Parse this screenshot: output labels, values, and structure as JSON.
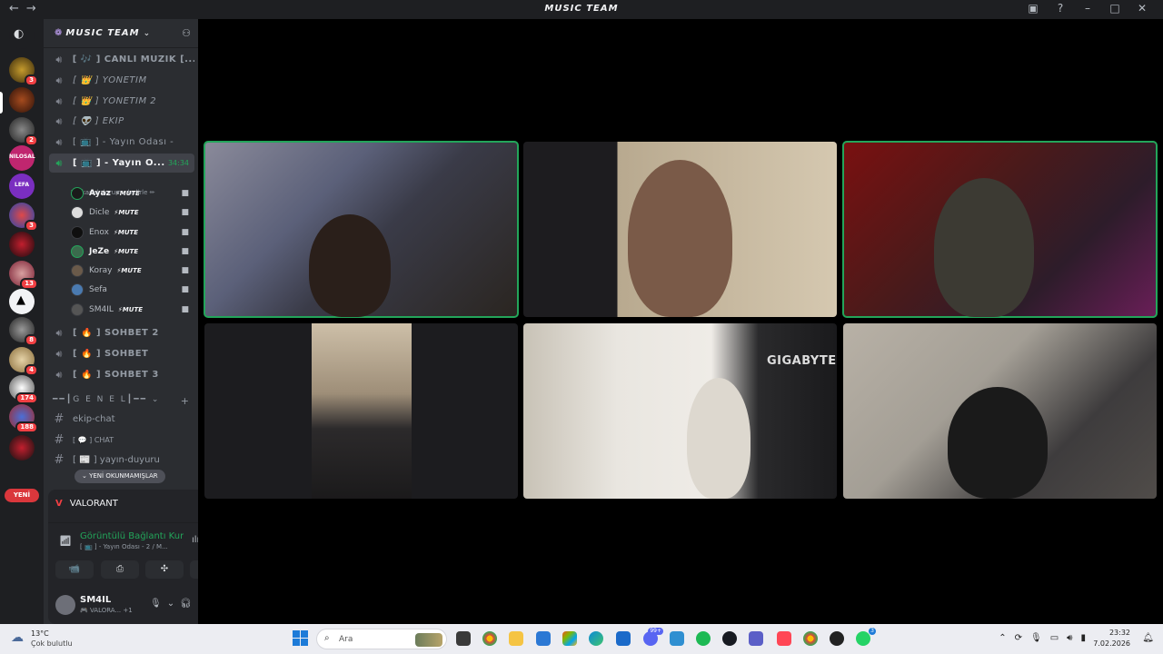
{
  "window": {
    "title": "MUSIC TEAM",
    "nav_back": "←",
    "nav_forward": "→"
  },
  "guilds": {
    "badges": [
      "3",
      "2",
      "3",
      "13",
      "8",
      "4",
      "174",
      "188"
    ],
    "labels": {
      "nilosal": "NILOSAL",
      "lefa": "LEFA"
    },
    "new_pill": "YENİ"
  },
  "server": {
    "name": "MUSIC TEAM"
  },
  "voice_channels": [
    {
      "label": "[ 🎶 ] CANLI MÜZİK [...",
      "style": "bold"
    },
    {
      "label": "[ 👑 ] YÖNETİM",
      "style": "italic"
    },
    {
      "label": "[ 👑 ] YÖNETİM 2",
      "style": "italic"
    },
    {
      "label": "[ 👽 ] EKİP",
      "style": "italic"
    },
    {
      "label": "[ 📺 ] - Yayın Odası -",
      "style": "normal"
    },
    {
      "label": "[ 📺 ] - Yayın O...",
      "style": "bold",
      "active": true,
      "timer": "34:34"
    }
  ],
  "channel_status": "Bir kanal durumu belirle ✏",
  "members": [
    {
      "name": "Ayaz",
      "mute": "⚡MUTE"
    },
    {
      "name": "Dicle",
      "mute": "⚡MUTE"
    },
    {
      "name": "Enox",
      "mute": "⚡MUTE"
    },
    {
      "name": "JeZe",
      "mute": "⚡MUTE"
    },
    {
      "name": "Koray",
      "mute": "⚡MUTE"
    },
    {
      "name": "Sefa",
      "mute": ""
    },
    {
      "name": "SM4IL",
      "mute": "⚡MUTE"
    }
  ],
  "more_voice_channels": [
    {
      "label": "[ 🔥 ] SOHBET 2"
    },
    {
      "label": "[ 🔥 ] SOHBET"
    },
    {
      "label": "[ 🔥 ] SOHBET 3"
    }
  ],
  "category": {
    "label": "━━┃G E N E L┃━━ ⌄",
    "plus": "+"
  },
  "text_channels": [
    {
      "label": "ekip-chat"
    },
    {
      "label": "[ 💬 ] CHAT"
    },
    {
      "label": "[ 📰 ] yayın-duyuru"
    }
  ],
  "unread_pill": "⌄ YENİ OKUNMAMIŞLAR",
  "panel": {
    "game": "VALORANT",
    "connection": "Görüntülü Bağlantı Kuruldu",
    "connection_sub": "[ 📺 ] - Yayın Odası - 2 / M...",
    "username": "SM4IL",
    "user_status": "🎮 VALORA... +1",
    "buttons": [
      "📹",
      "⎙",
      "✣",
      "✺"
    ]
  },
  "video_tiles": [
    {
      "name": "tile-1",
      "speaking": true
    },
    {
      "name": "tile-2",
      "speaking": false
    },
    {
      "name": "tile-3",
      "speaking": true
    },
    {
      "name": "tile-4",
      "speaking": false
    },
    {
      "name": "tile-5",
      "speaking": false,
      "overlay_text": "GIGABYTE"
    },
    {
      "name": "tile-6",
      "speaking": false
    }
  ],
  "taskbar": {
    "weather_temp": "13°C",
    "weather_cond": "Çok bulutlu",
    "search_placeholder": "Ara",
    "discord_badge": "99+",
    "whatsapp_badge": "3",
    "time": "23:32",
    "date": "7.02.2026"
  },
  "colors": {
    "green": "#23a55a",
    "red": "#f23f43",
    "blurple": "#5865f2",
    "sidebar": "#2b2d31",
    "rail": "#1e1f22"
  }
}
